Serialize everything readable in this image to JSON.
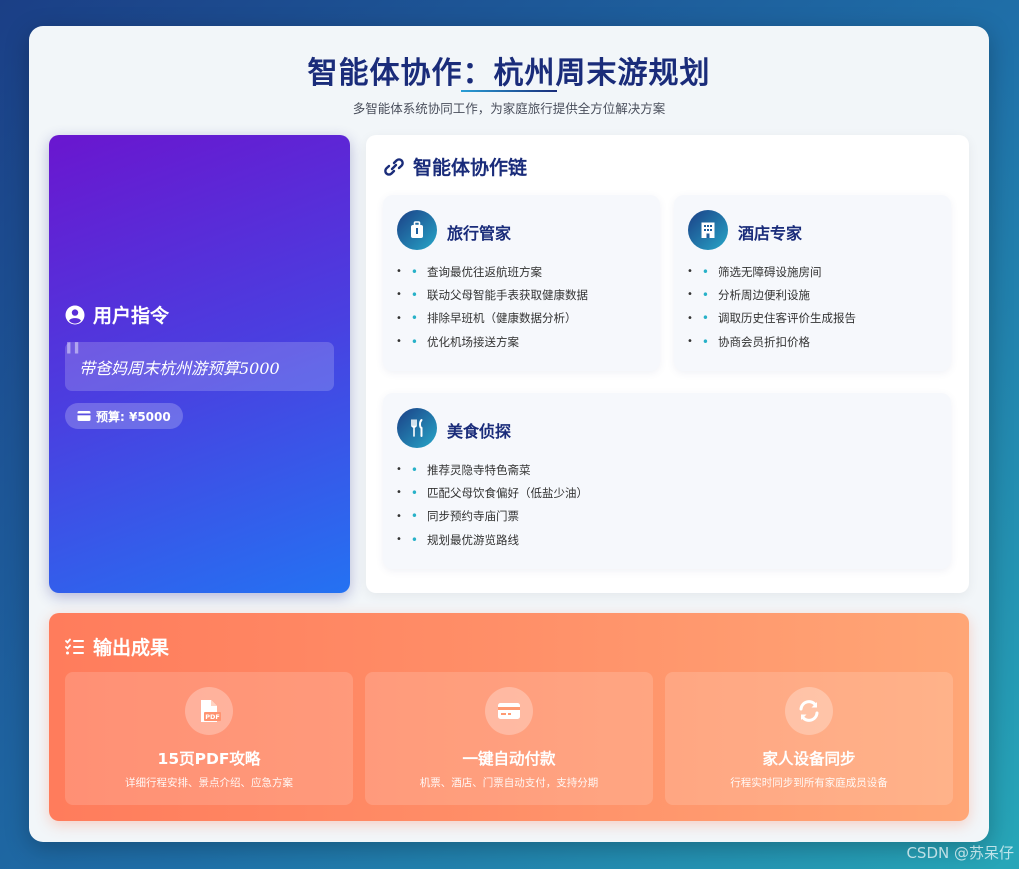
{
  "header": {
    "title": "智能体协作：杭州周末游规划",
    "subtitle": "多智能体系统协同工作，为家庭旅行提供全方位解决方案"
  },
  "user": {
    "heading": "用户指令",
    "command": "带爸妈周末杭州游预算5000",
    "budget": "预算: ¥5000",
    "icon": "user-circle-icon"
  },
  "chain": {
    "heading": "智能体协作链",
    "icon": "link-icon",
    "agents": [
      {
        "name": "旅行管家",
        "icon": "suitcase-icon",
        "items": [
          "查询最优往返航班方案",
          "联动父母智能手表获取健康数据",
          "排除早班机（健康数据分析）",
          "优化机场接送方案"
        ]
      },
      {
        "name": "酒店专家",
        "icon": "hotel-icon",
        "items": [
          "筛选无障碍设施房间",
          "分析周边便利设施",
          "调取历史住客评价生成报告",
          "协商会员折扣价格"
        ]
      },
      {
        "name": "美食侦探",
        "icon": "utensils-icon",
        "items": [
          "推荐灵隐寺特色斋菜",
          "匹配父母饮食偏好（低盐少油）",
          "同步预约寺庙门票",
          "规划最优游览路线"
        ]
      }
    ]
  },
  "output": {
    "heading": "输出成果",
    "icon": "checklist-icon",
    "cards": [
      {
        "title": "15页PDF攻略",
        "desc": "详细行程安排、景点介绍、应急方案",
        "icon": "pdf-file-icon"
      },
      {
        "title": "一键自动付款",
        "desc": "机票、酒店、门票自动支付，支持分期",
        "icon": "credit-card-icon"
      },
      {
        "title": "家人设备同步",
        "desc": "行程实时同步到所有家庭成员设备",
        "icon": "sync-icon"
      }
    ]
  },
  "watermark": "CSDN @苏呆仔",
  "colors": {
    "primary": "#1a2c7a",
    "accent": "#27b1c8",
    "user_gradient_start": "#6a16cf",
    "user_gradient_end": "#2472f2",
    "output_gradient_start": "#ff7c5c",
    "output_gradient_end": "#ffa676"
  }
}
